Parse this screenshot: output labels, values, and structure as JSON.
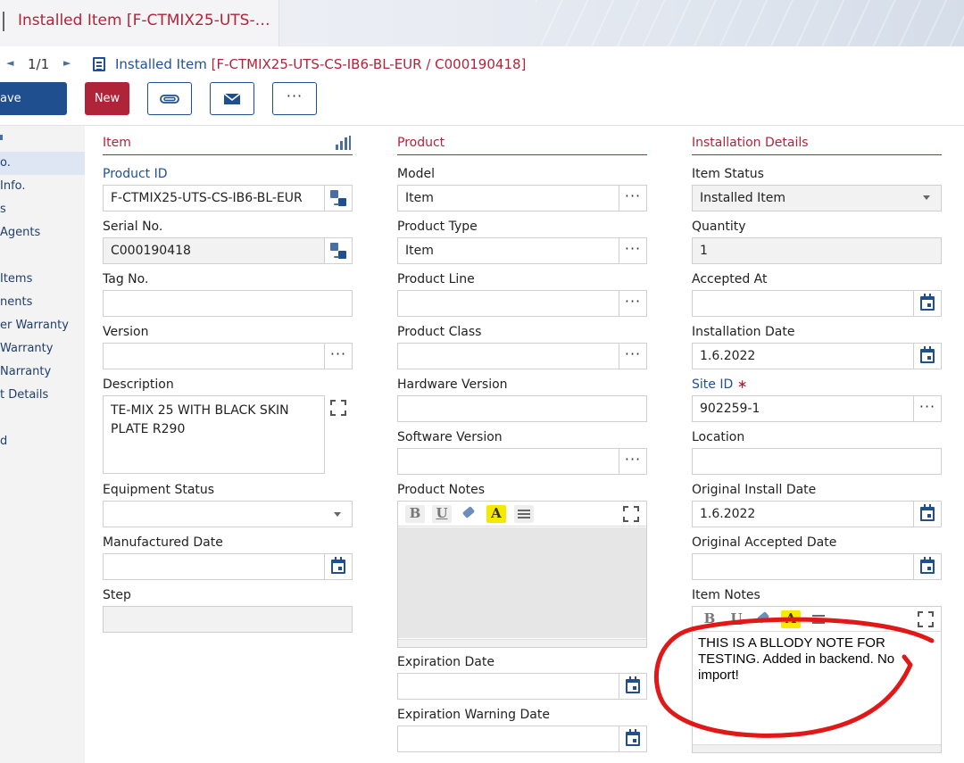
{
  "tab": {
    "title": "Installed Item [F-CTMIX25-UTS-…"
  },
  "nav": {
    "count": "1/1",
    "prev": "◄",
    "next": "►"
  },
  "breadcrumb": {
    "title": "Installed Item",
    "record": "[F-CTMIX25-UTS-CS-IB6-BL-EUR / C000190418]"
  },
  "toolbar": {
    "save_label": "ave",
    "new_label": "New",
    "dots_label": "···"
  },
  "sidebar": {
    "items": [
      {
        "label": "o."
      },
      {
        "label": "Info."
      },
      {
        "label": "s"
      },
      {
        "label": "Agents"
      },
      {
        "label": "Items"
      },
      {
        "label": "nents"
      },
      {
        "label": "er Warranty"
      },
      {
        "label": "Warranty"
      },
      {
        "label": "Narranty"
      },
      {
        "label": "t Details"
      },
      {
        "label": "d"
      }
    ]
  },
  "item": {
    "title": "Item",
    "product_id_label": "Product ID",
    "product_id": "F-CTMIX25-UTS-CS-IB6-BL-EUR",
    "serial_label": "Serial No.",
    "serial": "C000190418",
    "tag_label": "Tag No.",
    "tag": "",
    "version_label": "Version",
    "version": "",
    "description_label": "Description",
    "description": "TE-MIX 25 WITH BLACK SKIN PLATE R290",
    "equipment_status_label": "Equipment Status",
    "equipment_status": "",
    "manufactured_label": "Manufactured Date",
    "manufactured": "",
    "step_label": "Step",
    "step": ""
  },
  "product": {
    "title": "Product",
    "model_label": "Model",
    "model": "Item",
    "type_label": "Product Type",
    "type": "Item",
    "line_label": "Product Line",
    "line": "",
    "class_label": "Product Class",
    "class": "",
    "hw_label": "Hardware Version",
    "hw": "",
    "sw_label": "Software Version",
    "sw": "",
    "notes_label": "Product Notes",
    "expiration_label": "Expiration Date",
    "expiration": "",
    "expiration_warning_label": "Expiration Warning Date",
    "expiration_warning": ""
  },
  "installation": {
    "title": "Installation Details",
    "status_label": "Item Status",
    "status": "Installed Item",
    "quantity_label": "Quantity",
    "quantity": "1",
    "accepted_label": "Accepted At",
    "accepted": "",
    "install_date_label": "Installation Date",
    "install_date": "1.6.2022",
    "site_label": "Site ID",
    "site_required": "∗",
    "site": "902259-1",
    "location_label": "Location",
    "location": "",
    "orig_install_label": "Original Install Date",
    "orig_install": "1.6.2022",
    "orig_accepted_label": "Original Accepted Date",
    "orig_accepted": "",
    "notes_label": "Item Notes",
    "notes_text": "THIS IS A BLLODY NOTE FOR TESTING. Added in backend. No import!"
  },
  "editor_buttons": {
    "bold": "B",
    "underline": "U",
    "highlight": "A"
  },
  "colors": {
    "brand_blue": "#1f4f8e",
    "accent_red": "#b0243a",
    "annotation_red": "#e01818"
  }
}
